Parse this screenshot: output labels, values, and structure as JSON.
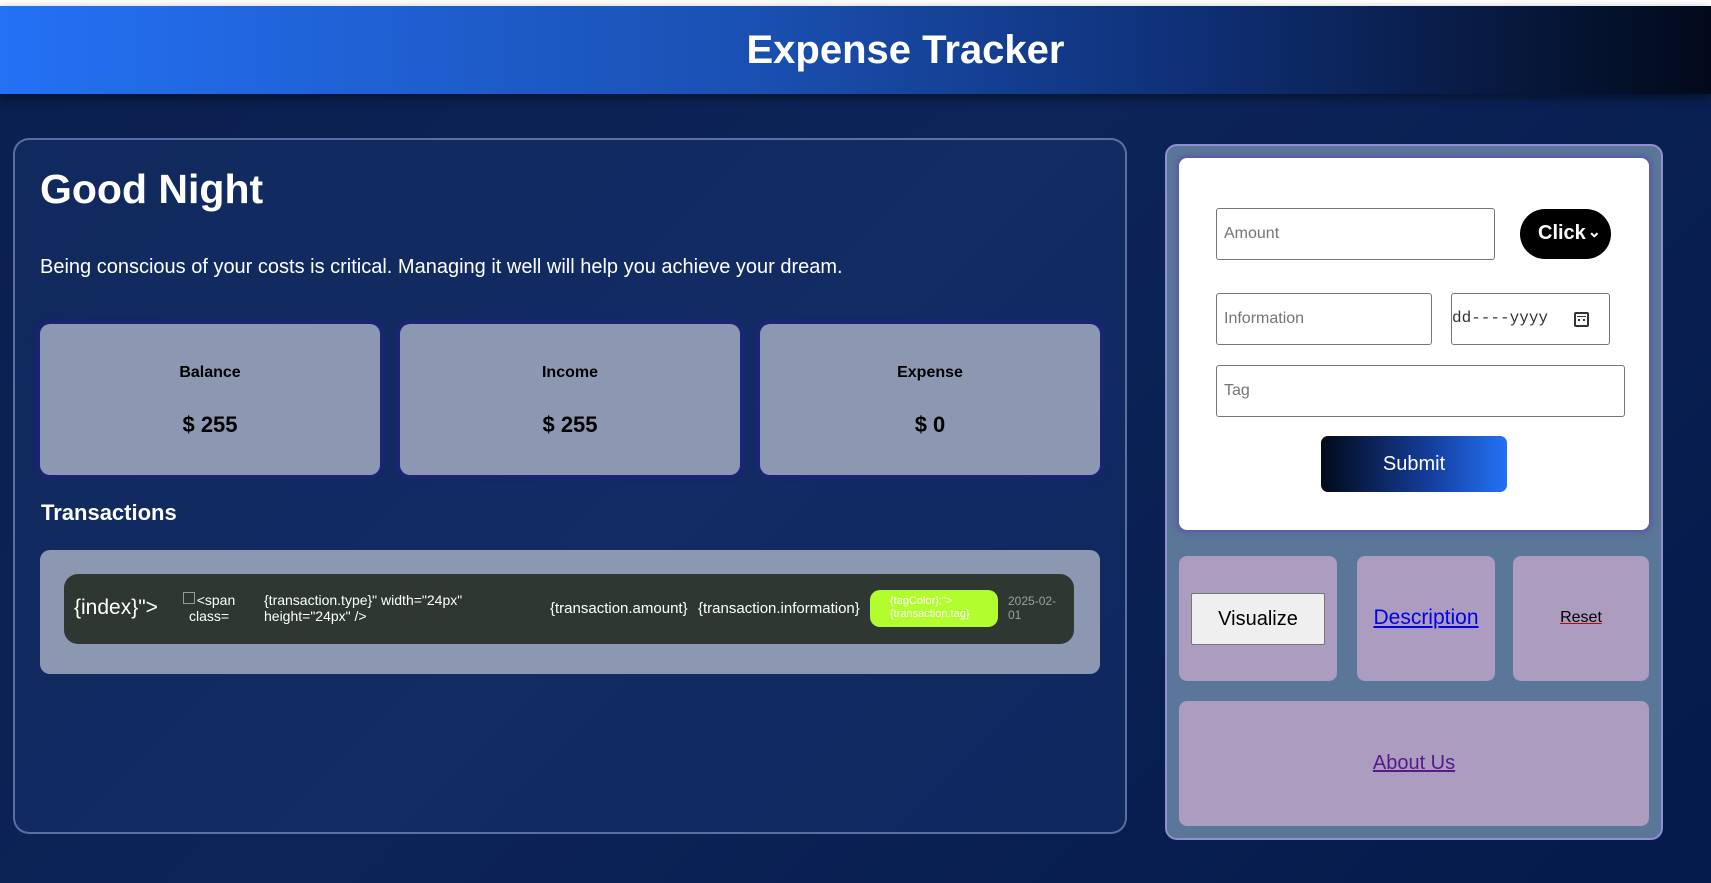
{
  "header": {
    "title": "Expense Tracker"
  },
  "main": {
    "greeting": "Good Night",
    "tagline": "Being conscious of your costs is critical. Managing it well will help you achieve your dream.",
    "cards": [
      {
        "label": "Balance",
        "value": "$ 255"
      },
      {
        "label": "Income",
        "value": "$ 255"
      },
      {
        "label": "Expense",
        "value": "$ 0"
      }
    ],
    "transactions_title": "Transactions",
    "transaction": {
      "index": "{index}\">",
      "img_alt": "<span class=",
      "type_text": "{transaction.type}\" width=\"24px\" height=\"24px\" />",
      "amount": "{transaction.amount}",
      "information": "{transaction.information}",
      "tag": "{tagColor};\">{transaction.tag}",
      "tag_color": "#b2fd2e",
      "date": "2025-02-01"
    }
  },
  "form": {
    "amount_placeholder": "Amount",
    "type_select_value": "Click",
    "information_placeholder": "Information",
    "date_value": "dd----yyyy",
    "tag_placeholder": "Tag",
    "submit_label": "Submit"
  },
  "actions": {
    "visualize_label": "Visualize",
    "description_label": "Description",
    "reset_label": "Reset",
    "about_label": "About Us"
  },
  "colors": {
    "card_bg": "#8c98b2",
    "tile_bg": "#ac9cbf",
    "row_bg": "#2f3733",
    "link_blue": "#0000ee",
    "link_visited": "#551a8b"
  }
}
